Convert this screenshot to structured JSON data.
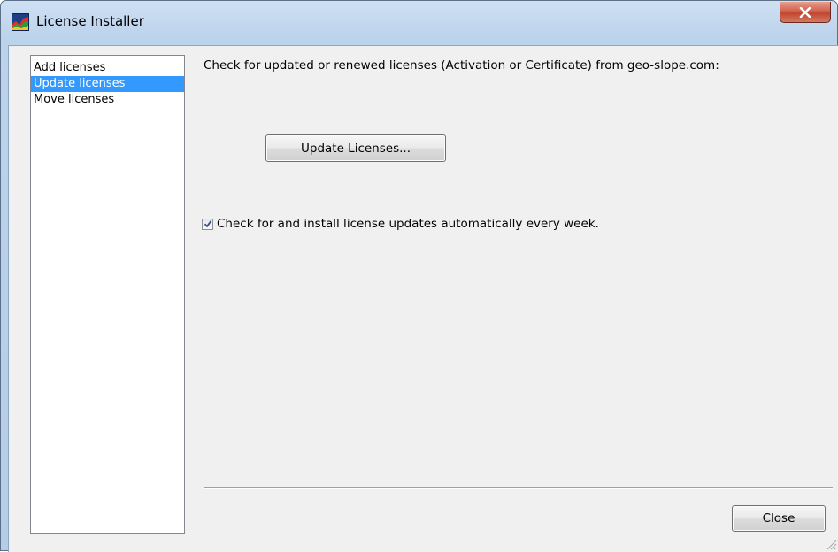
{
  "window": {
    "title": "License Installer",
    "icon": "app-chart-icon",
    "close_icon": "close-icon"
  },
  "nav": {
    "items": [
      {
        "label": "Add licenses",
        "selected": false
      },
      {
        "label": "Update licenses",
        "selected": true
      },
      {
        "label": "Move licenses",
        "selected": false
      }
    ]
  },
  "main": {
    "heading": "Check for updated or renewed licenses (Activation or Certificate) from geo-slope.com:",
    "update_button": "Update Licenses...",
    "auto_update": {
      "label": "Check for and install license updates automatically every week.",
      "checked": true
    }
  },
  "footer": {
    "close_button": "Close"
  },
  "colors": {
    "selection": "#3399ff",
    "close_button_red": "#c14630",
    "frame": "#b6cde7"
  }
}
